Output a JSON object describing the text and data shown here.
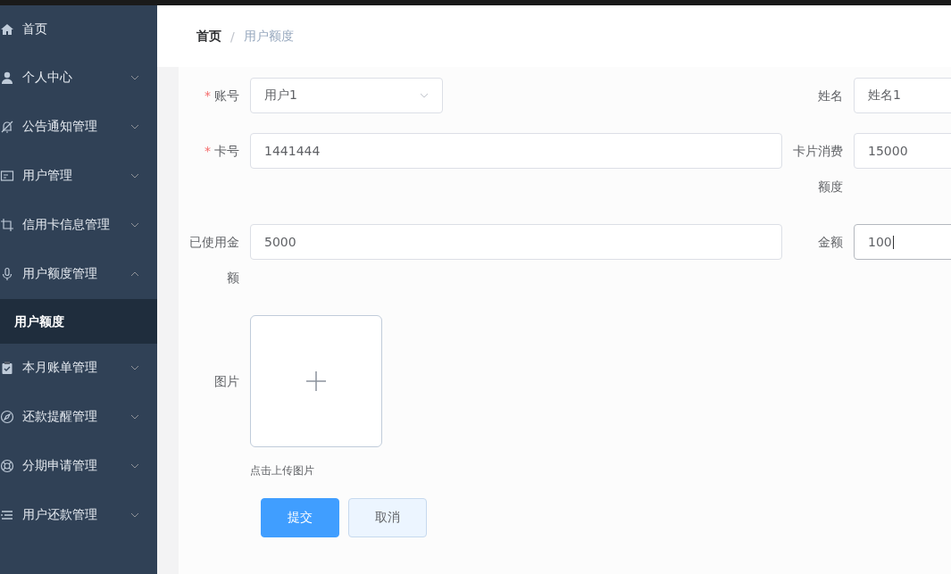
{
  "sidebar": {
    "items": [
      {
        "label": "首页"
      },
      {
        "label": "个人中心",
        "expanded": false
      },
      {
        "label": "公告通知管理",
        "expanded": false
      },
      {
        "label": "用户管理",
        "expanded": false
      },
      {
        "label": "信用卡信息管理",
        "expanded": false
      },
      {
        "label": "用户额度管理",
        "expanded": true,
        "children": [
          {
            "label": "用户额度",
            "selected": true
          }
        ]
      },
      {
        "label": "本月账单管理",
        "expanded": false
      },
      {
        "label": "还款提醒管理",
        "expanded": false
      },
      {
        "label": "分期申请管理",
        "expanded": false
      },
      {
        "label": "用户还款管理",
        "expanded": false
      }
    ]
  },
  "breadcrumb": {
    "items": [
      "首页",
      "用户额度"
    ],
    "separator": "/"
  },
  "form": {
    "required_mark": "*",
    "rows": [
      {
        "left": {
          "label": "账号",
          "required": true,
          "kind": "select",
          "value": "用户1"
        },
        "right": {
          "label": "姓名",
          "required": false,
          "kind": "input",
          "value": "姓名1",
          "focused": false
        }
      },
      {
        "left": {
          "label": "卡号",
          "required": true,
          "kind": "input",
          "value": "1441444",
          "focused": false
        },
        "right": {
          "label": "卡片消费额度",
          "required": false,
          "kind": "input",
          "value": "15000",
          "focused": false
        }
      },
      {
        "left": {
          "label": "已使用金额",
          "required": false,
          "kind": "input",
          "value": "5000",
          "focused": false
        },
        "right": {
          "label": "金额",
          "required": false,
          "kind": "input",
          "value": "100",
          "focused": true
        }
      }
    ],
    "upload": {
      "label": "图片",
      "hint": "点击上传图片"
    },
    "buttons": [
      {
        "label": "提交",
        "kind": "primary"
      },
      {
        "label": "取消",
        "kind": "plain"
      }
    ]
  }
}
